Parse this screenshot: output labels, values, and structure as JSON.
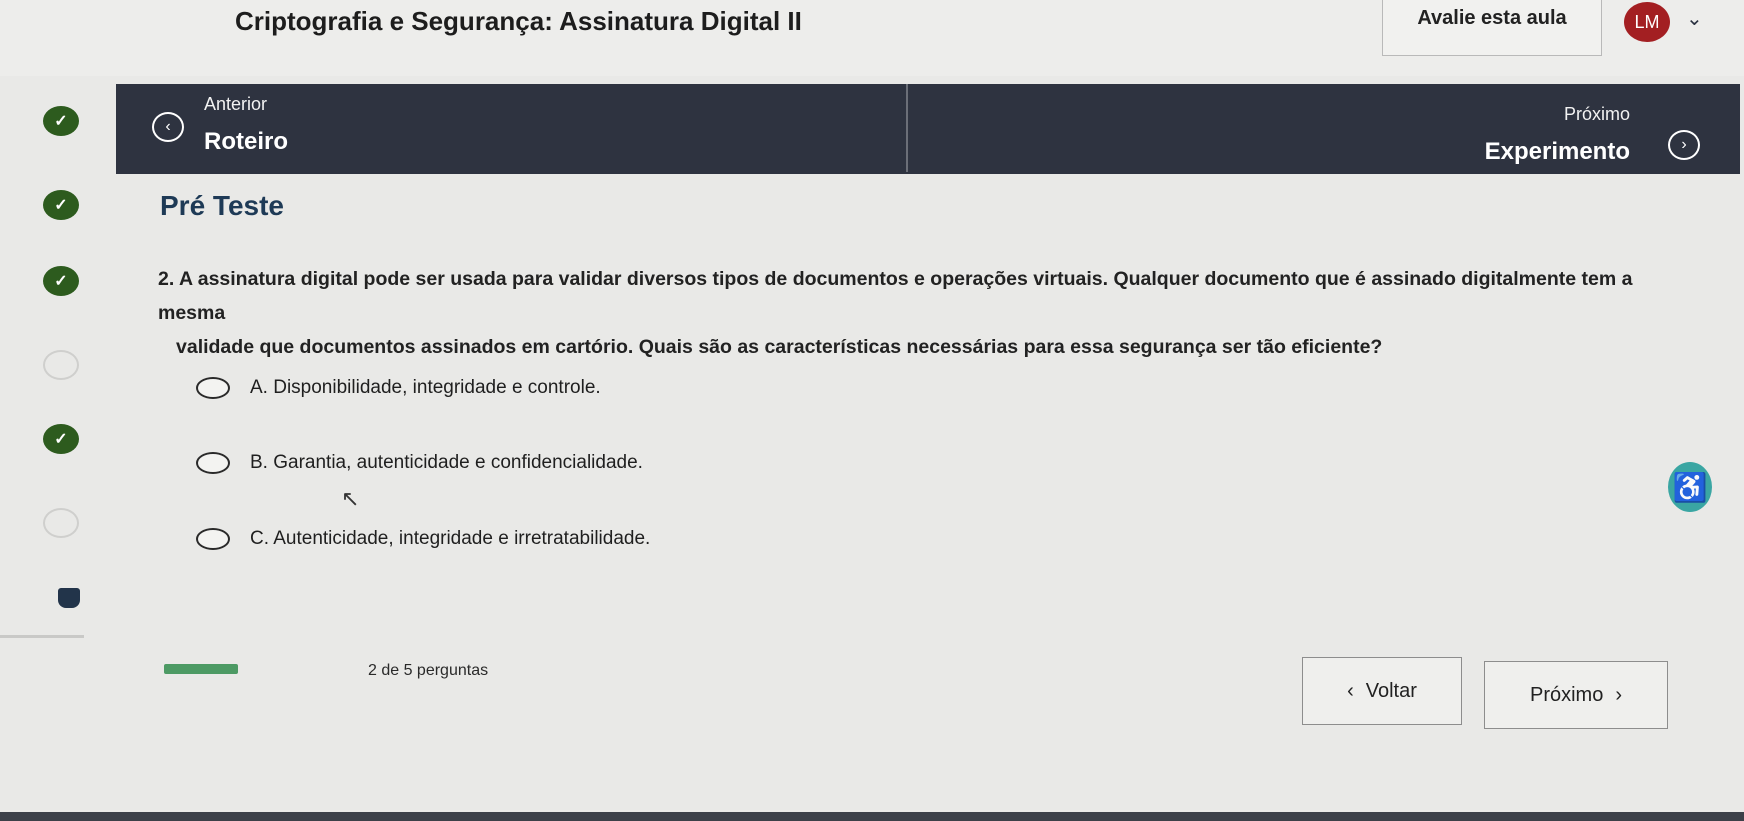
{
  "header": {
    "course_title": "Criptografia e Segurança: Assinatura Digital II",
    "rate_label": "Avalie esta aula",
    "avatar_initials": "LM"
  },
  "nav": {
    "prev_small": "Anterior",
    "prev_big": "Roteiro",
    "next_small": "Próximo",
    "next_big": "Experimento"
  },
  "content": {
    "section_title": "Pré Teste",
    "question_line1": "2. A assinatura digital pode ser usada para validar diversos tipos de documentos e operações virtuais. Qualquer documento que é assinado digitalmente tem a mesma",
    "question_line2": "validade que documentos assinados em cartório. Quais são as características necessárias para essa segurança ser tão eficiente?",
    "options": [
      {
        "label": "A. Disponibilidade, integridade e controle."
      },
      {
        "label": "B. Garantia, autenticidade e confidencialidade."
      },
      {
        "label": "C. Autenticidade, integridade e irretratabilidade."
      }
    ]
  },
  "footer": {
    "progress_text": "2 de 5 perguntas",
    "progress_fraction": 0.4,
    "back_label": "Voltar",
    "next_label": "Próximo"
  },
  "colors": {
    "nav_band": "#2e3340",
    "completed_dot": "#2d5b1e",
    "section_title": "#1e3a56",
    "avatar": "#a31f22",
    "progress": "#4d9a64",
    "assistant": "#3aa6a3"
  },
  "icons": [
    "chevron-down-icon",
    "check-icon",
    "chevron-left-icon",
    "chevron-right-icon",
    "trophy-icon",
    "accessibility-icon",
    "cursor-icon"
  ]
}
